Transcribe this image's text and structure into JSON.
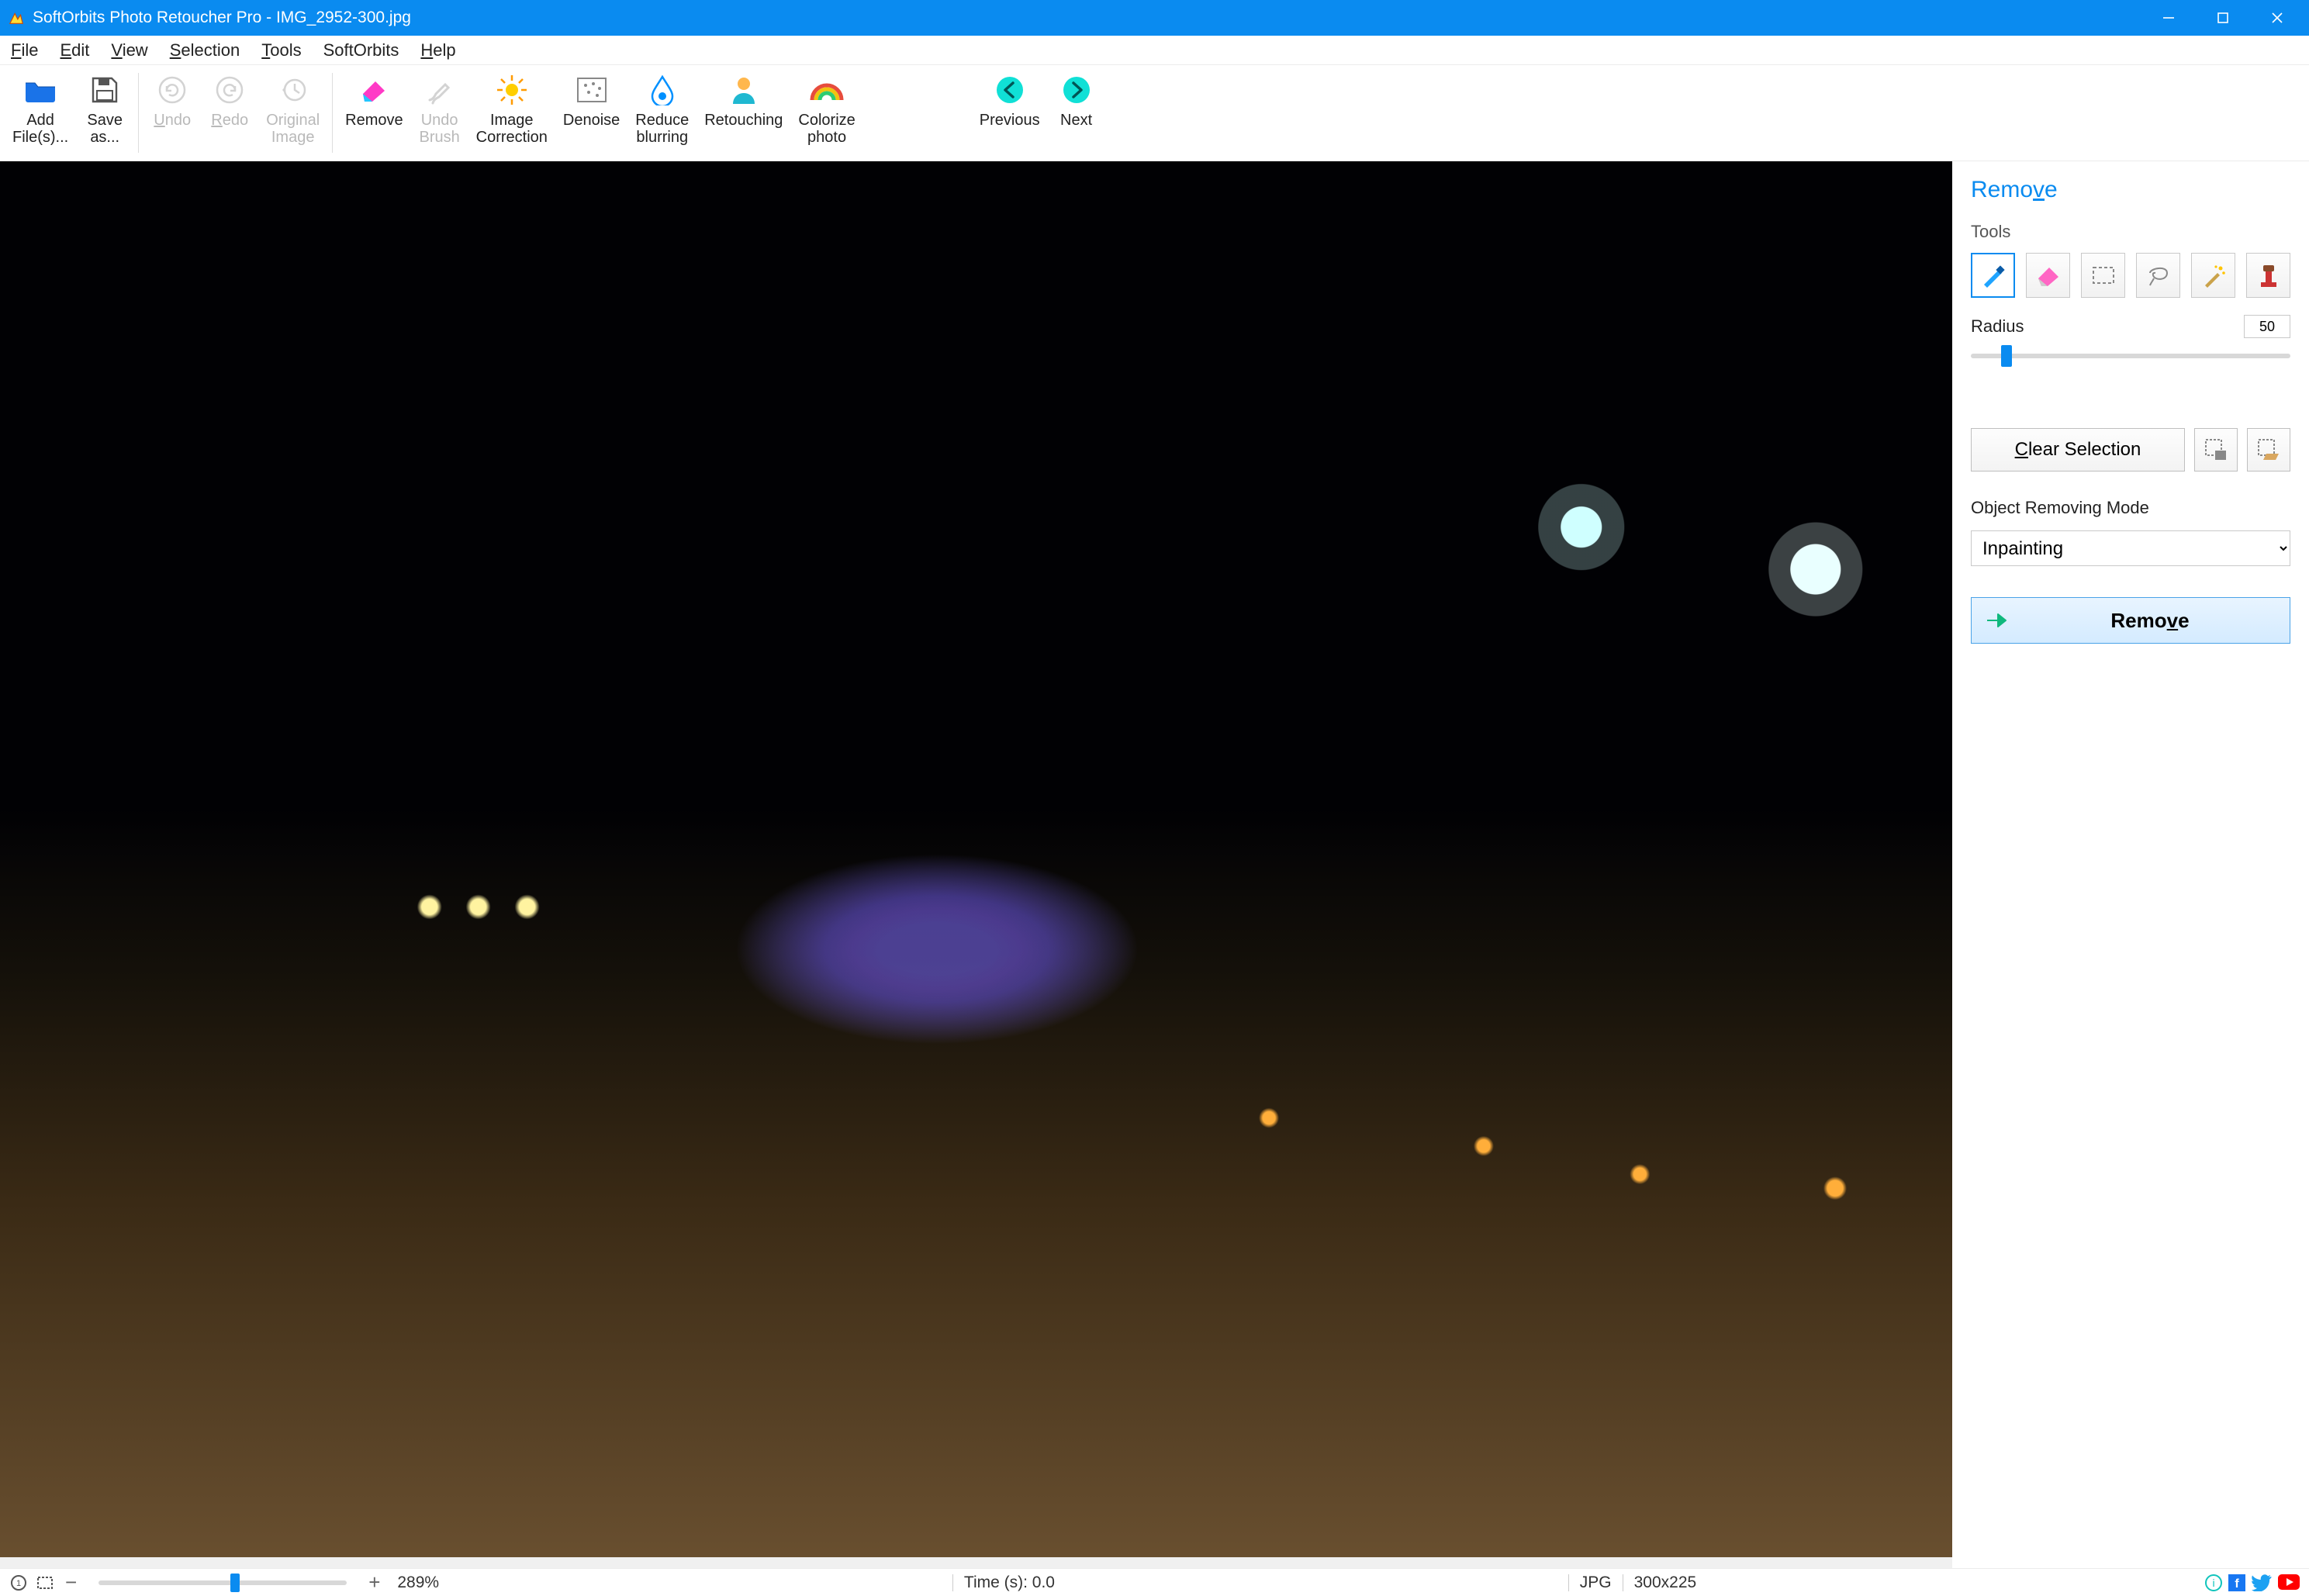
{
  "title": "SoftOrbits Photo Retoucher Pro - IMG_2952-300.jpg",
  "menu": {
    "file": "File",
    "edit": "Edit",
    "view": "View",
    "selection": "Selection",
    "tools": "Tools",
    "softorbits": "SoftOrbits",
    "help": "Help"
  },
  "ribbon": {
    "add_files_l1": "Add",
    "add_files_l2": "File(s)...",
    "save_as_l1": "Save",
    "save_as_l2": "as...",
    "undo": "Undo",
    "redo": "Redo",
    "original_l1": "Original",
    "original_l2": "Image",
    "remove": "Remove",
    "undo_brush_l1": "Undo",
    "undo_brush_l2": "Brush",
    "image_corr_l1": "Image",
    "image_corr_l2": "Correction",
    "denoise": "Denoise",
    "reduce_blur_l1": "Reduce",
    "reduce_blur_l2": "blurring",
    "retouch": "Retouching",
    "colorize_l1": "Colorize",
    "colorize_l2": "photo",
    "previous": "Previous",
    "next": "Next"
  },
  "panel": {
    "title": "Remove",
    "tools_label": "Tools",
    "radius_label": "Radius",
    "radius_value": "50",
    "clear_selection": "Clear Selection",
    "mode_label": "Object Removing Mode",
    "mode_value": "Inpainting",
    "remove_button": "Remove"
  },
  "status": {
    "zoom_pct": "289%",
    "time": "Time (s): 0.0",
    "format": "JPG",
    "dims": "300x225"
  }
}
